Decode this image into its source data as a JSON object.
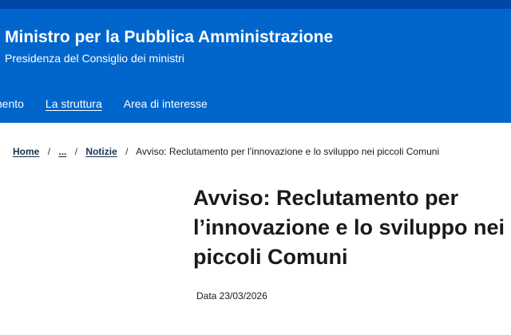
{
  "header": {
    "title": "Ministro per la Pubblica Amministrazione",
    "subtitle": "Presidenza del Consiglio dei ministri"
  },
  "nav": {
    "items": [
      {
        "label": "mento"
      },
      {
        "label": "La struttura",
        "active": true
      },
      {
        "label": "Area di interesse"
      }
    ]
  },
  "breadcrumb": {
    "home": "Home",
    "ellipsis": "...",
    "news": "Notizie",
    "current": "Avviso: Reclutamento per l’innovazione e lo sviluppo nei piccoli Comuni",
    "separator": "/"
  },
  "article": {
    "title": "Avviso: Reclutamento per l’innovazione e lo sviluppo nei piccoli Comuni",
    "date": "Data 23/03/2026"
  },
  "colors": {
    "header_bg": "#0066cc",
    "top_bar": "#0047a8",
    "link": "#17324d"
  }
}
